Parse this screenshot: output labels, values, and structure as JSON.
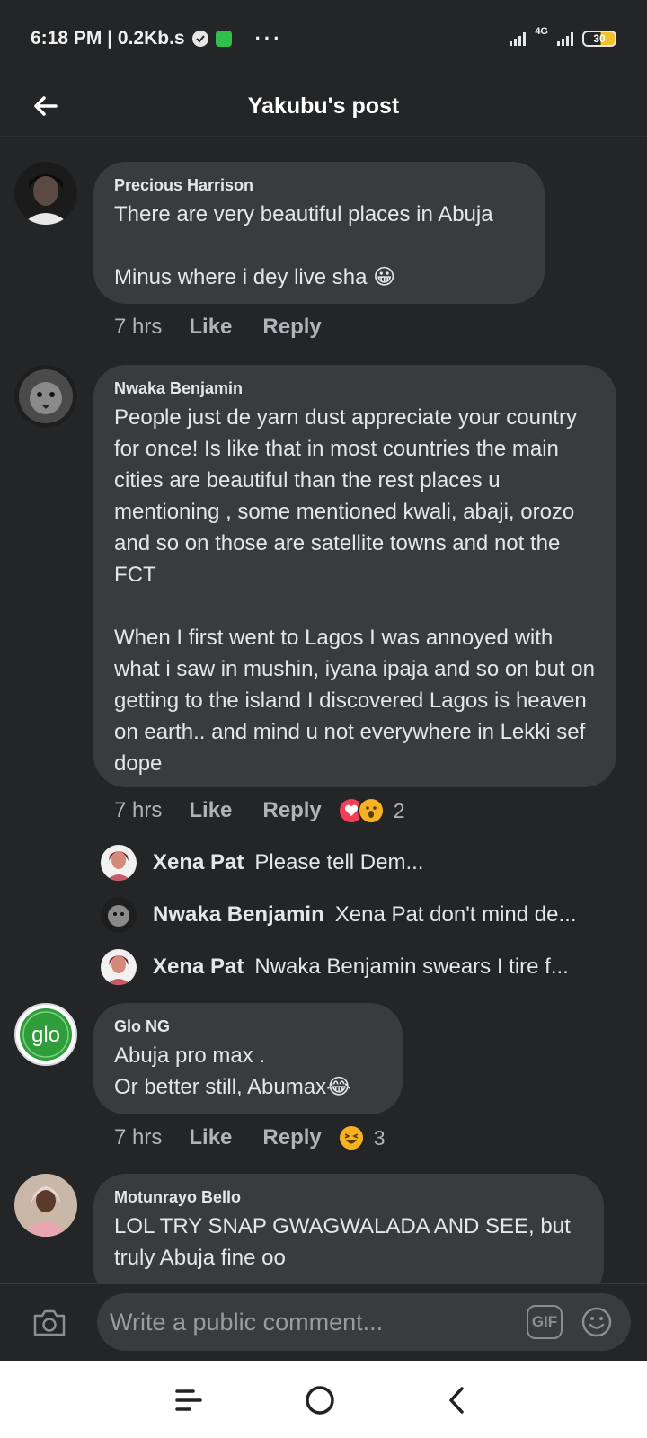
{
  "status_bar": {
    "time": "6:18 PM | 0.2Kb.s",
    "more": "···",
    "network": "4G",
    "battery": "30"
  },
  "header": {
    "title": "Yakubu's post"
  },
  "comments": [
    {
      "name": "Precious Harrison",
      "text": "There are very beautiful places in Abuja\n\nMinus where i dey live sha 😀",
      "time": "7 hrs",
      "like": "Like",
      "reply": "Reply"
    },
    {
      "name": "Nwaka Benjamin",
      "text": "People just de yarn dust appreciate your country for once! Is like that in most countries the main cities are beautiful than the rest places u mentioning , some mentioned kwali, abaji, orozo and so on those are satellite towns and not the FCT\n\nWhen I first went to Lagos I was annoyed with what i saw in mushin, iyana ipaja and so on but on getting to the island I discovered Lagos is heaven on earth.. and mind u not everywhere in Lekki sef dope",
      "time": "7 hrs",
      "like": "Like",
      "reply": "Reply",
      "reaction_count": "2"
    },
    {
      "name": "Glo NG",
      "text": "Abuja pro max .\nOr better still, Abumax😂",
      "time": "7 hrs",
      "like": "Like",
      "reply": "Reply",
      "reaction_count": "3"
    },
    {
      "name": "Motunrayo Bello",
      "text": "LOL TRY SNAP GWAGWALADA AND SEE, but truly Abuja fine oo"
    }
  ],
  "replies": [
    {
      "name": "Xena Pat",
      "text": "Please tell Dem..."
    },
    {
      "name": "Nwaka Benjamin",
      "text": "Xena Pat don't mind de..."
    },
    {
      "name": "Xena Pat",
      "text": "Nwaka Benjamin swears I tire f..."
    }
  ],
  "glo_logo_text": "glo",
  "composer": {
    "placeholder": "Write a public comment...",
    "gif": "GIF"
  },
  "colors": {
    "background": "#242526",
    "bubble": "#3a3b3c",
    "glo_green": "#2e9d3a",
    "love": "#f33e58",
    "wow": "#f7b125"
  }
}
